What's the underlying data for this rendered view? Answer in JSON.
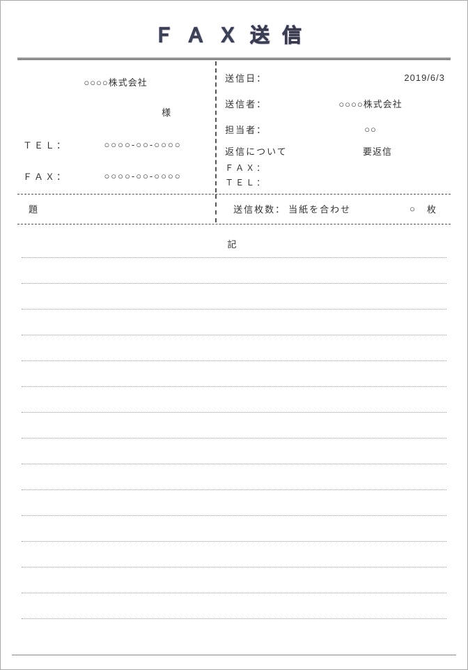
{
  "title": "ＦＡＸ送信",
  "left": {
    "recipient_company": "○○○○株式会社",
    "recipient_honorific": "様",
    "tel_label": "ＴＥＬ：",
    "tel_value": "○○○○-○○-○○○○",
    "fax_label": "ＦＡＸ：",
    "fax_value": "○○○○-○○-○○○○"
  },
  "right": {
    "send_date_label": "送信日：",
    "send_date_value": "2019/6/3",
    "sender_label": "送信者：",
    "sender_value": "○○○○株式会社",
    "person_label": "担当者：",
    "person_value": "○○",
    "reply_label": "返信について",
    "reply_value": "要返信",
    "fax_label": "ＦＡＸ：",
    "fax_value": "",
    "tel_label": "ＴＥＬ：",
    "tel_value": ""
  },
  "meta": {
    "subject_label": "題",
    "pages_label": "送信枚数：",
    "pages_note": "当紙を合わせ",
    "pages_count": "○",
    "pages_unit": "枚"
  },
  "notes_heading": "記"
}
